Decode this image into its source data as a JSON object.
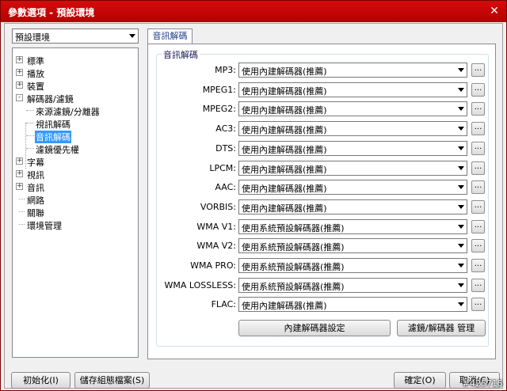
{
  "window": {
    "title": "參數選項 - 預設環境",
    "close_glyph": "✕"
  },
  "profile_combo": {
    "value": "預設環境"
  },
  "tree": {
    "items": [
      {
        "label": "標準",
        "expander": "+"
      },
      {
        "label": "播放",
        "expander": "+"
      },
      {
        "label": "裝置",
        "expander": "+"
      },
      {
        "label": "解碼器/濾鏡",
        "expander": "-"
      },
      {
        "label": "來源濾鏡/分離器"
      },
      {
        "label": "視訊解碼"
      },
      {
        "label": "音訊解碼"
      },
      {
        "label": "濾鏡優先權"
      },
      {
        "label": "字幕",
        "expander": "+"
      },
      {
        "label": "視訊",
        "expander": "+"
      },
      {
        "label": "音訊",
        "expander": "+"
      },
      {
        "label": "網路"
      },
      {
        "label": "關聯"
      },
      {
        "label": "環境管理"
      }
    ]
  },
  "tab": {
    "label": "音訊解碼"
  },
  "group": {
    "title": "音訊解碼"
  },
  "decoders": [
    {
      "label": "MP3:",
      "value": "使用內建解碼器(推薦)"
    },
    {
      "label": "MPEG1:",
      "value": "使用內建解碼器(推薦)"
    },
    {
      "label": "MPEG2:",
      "value": "使用內建解碼器(推薦)"
    },
    {
      "label": "AC3:",
      "value": "使用內建解碼器(推薦)"
    },
    {
      "label": "DTS:",
      "value": "使用內建解碼器(推薦)"
    },
    {
      "label": "LPCM:",
      "value": "使用內建解碼器(推薦)"
    },
    {
      "label": "AAC:",
      "value": "使用內建解碼器(推薦)"
    },
    {
      "label": "VORBIS:",
      "value": "使用內建解碼器(推薦)"
    },
    {
      "label": "WMA V1:",
      "value": "使用系統預設解碼器(推薦)"
    },
    {
      "label": "WMA V2:",
      "value": "使用系統預設解碼器(推薦)"
    },
    {
      "label": "WMA PRO:",
      "value": "使用系統預設解碼器(推薦)"
    },
    {
      "label": "WMA LOSSLESS:",
      "value": "使用系統預設解碼器(推薦)"
    },
    {
      "label": "FLAC:",
      "value": "使用內建解碼器(推薦)"
    }
  ],
  "ellipsis_label": "...",
  "buttons": {
    "builtin_settings": "內建解碼器設定",
    "filter_manage": "濾鏡/解碼器 管理",
    "initialize": "初始化(I)",
    "save_profile": "儲存組態檔案(S)",
    "ok": "確定(O)",
    "cancel": "取消(C)"
  },
  "watermark": "#425715"
}
